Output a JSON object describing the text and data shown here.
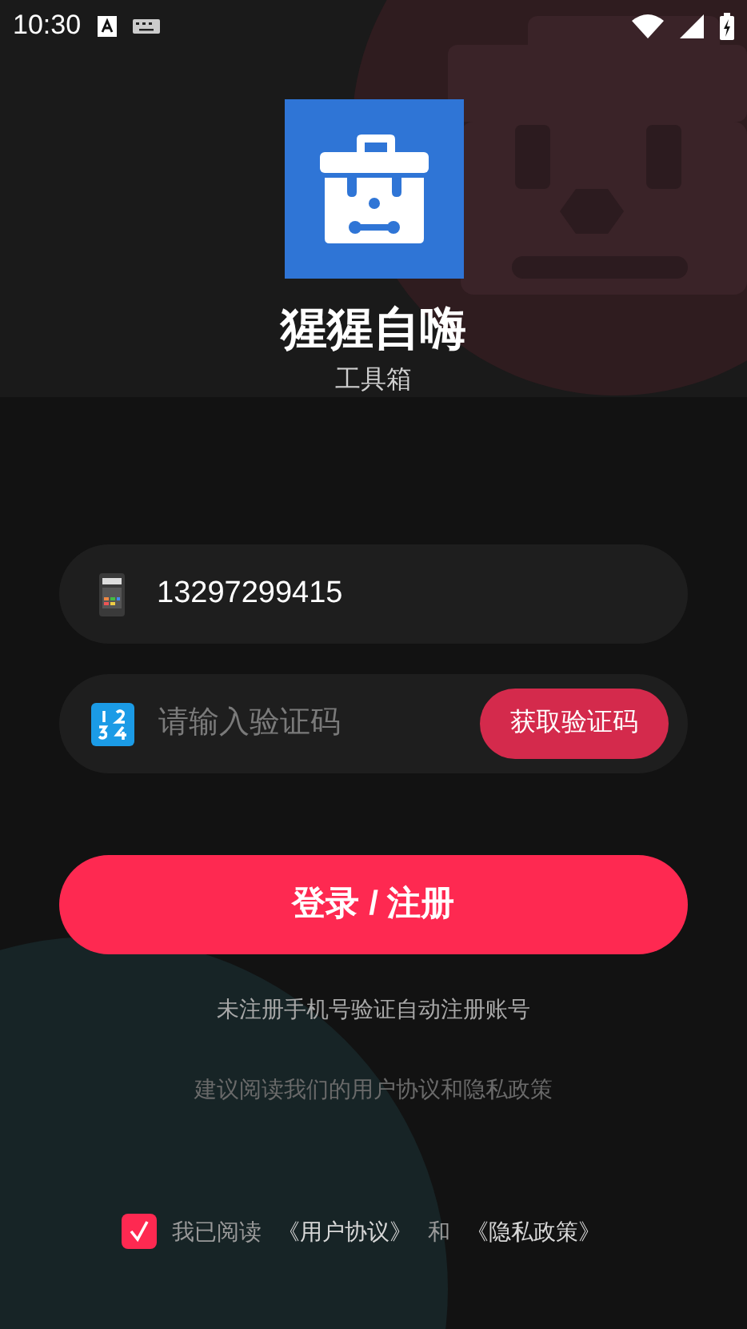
{
  "status_bar": {
    "time": "10:30"
  },
  "app": {
    "name": "猩猩自嗨",
    "subtitle": "工具箱"
  },
  "phone_field": {
    "value": "13297299415"
  },
  "code_field": {
    "placeholder": "请输入验证码",
    "button": "获取验证码"
  },
  "login_button": "登录 / 注册",
  "notes": [
    "未注册手机号验证自动注册账号",
    "建议阅读我们的用户协议和隐私政策"
  ],
  "agreement": {
    "checked": true,
    "prefix": "我已阅读",
    "links": [
      "《用户协议》",
      "《隐私政策》"
    ],
    "joiner": "和"
  }
}
